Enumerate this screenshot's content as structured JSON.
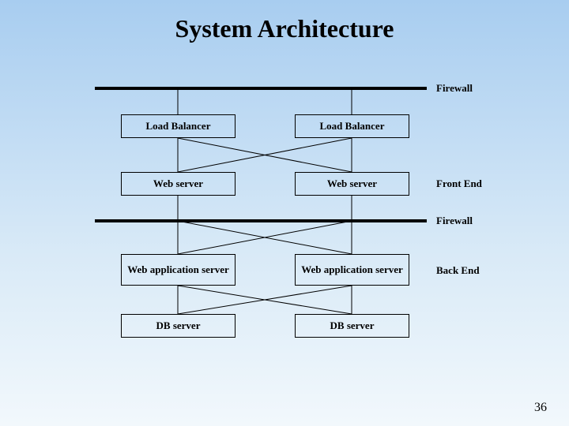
{
  "title": "System Architecture",
  "boxes": {
    "lb1": "Load Balancer",
    "lb2": "Load Balancer",
    "ws1": "Web server",
    "ws2": "Web server",
    "was1": "Web application server",
    "was2": "Web application server",
    "db1": "DB  server",
    "db2": "DB  server"
  },
  "labels": {
    "firewall1": "Firewall",
    "firewall2": "Firewall",
    "frontend": "Front End",
    "backend": "Back End"
  },
  "page": "36"
}
